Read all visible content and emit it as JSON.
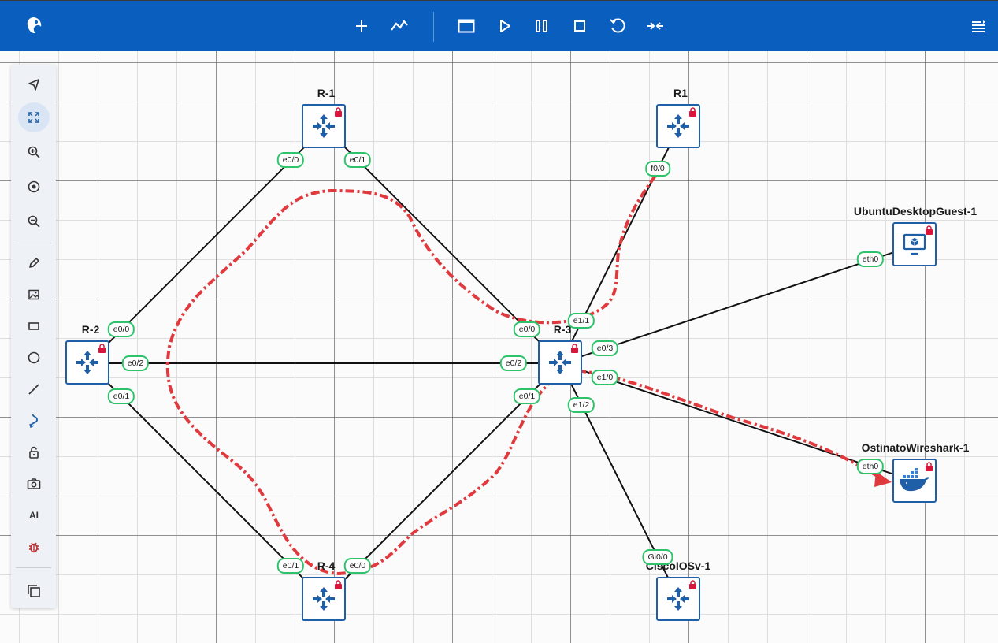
{
  "app": {
    "brand": "cml-logo-icon",
    "accent": "#0a5fbe"
  },
  "topbar": {
    "buttons": [
      "add-node",
      "graph",
      "console",
      "start",
      "pause",
      "stop",
      "reset",
      "collapse"
    ],
    "menu": "menu-icon"
  },
  "toolbox": {
    "tools": [
      "pointer",
      "fit-to-screen",
      "zoom-in",
      "center",
      "zoom-out",
      "pen",
      "image",
      "rectangle",
      "ellipse",
      "line",
      "curve",
      "lock",
      "camera",
      "ai",
      "bug",
      "copy"
    ],
    "ai_label": "AI",
    "active": "fit-to-screen"
  },
  "nodes": {
    "r_minus_1": {
      "label": "R-1",
      "type": "router",
      "locked": true
    },
    "r1": {
      "label": "R1",
      "type": "router",
      "locked": true
    },
    "r_minus_2": {
      "label": "R-2",
      "type": "router",
      "locked": true
    },
    "r_minus_3": {
      "label": "R-3",
      "type": "router",
      "locked": true
    },
    "r_minus_4": {
      "label": "R-4",
      "type": "router",
      "locked": true
    },
    "cisco_iosv_1": {
      "label": "CiscoIOSv-1",
      "type": "router",
      "locked": true
    },
    "ubuntu": {
      "label": "UbuntuDesktopGuest-1",
      "type": "desktop",
      "locked": true
    },
    "ostinato": {
      "label": "OstinatoWireshark-1",
      "type": "docker",
      "locked": true
    }
  },
  "interfaces": {
    "r_minus_1_e00": "e0/0",
    "r_minus_1_e01": "e0/1",
    "r1_f00": "f0/0",
    "ubuntu_eth0": "eth0",
    "r_minus_2_e00": "e0/0",
    "r_minus_2_e02": "e0/2",
    "r_minus_2_e01": "e0/1",
    "r_minus_3_e00": "e0/0",
    "r_minus_3_e11": "e1/1",
    "r_minus_3_e03": "e0/3",
    "r_minus_3_e02": "e0/2",
    "r_minus_3_e10": "e1/0",
    "r_minus_3_e01": "e0/1",
    "r_minus_3_e12": "e1/2",
    "ostinato_eth0": "eth0",
    "r_minus_4_e01": "e0/1",
    "r_minus_4_e00": "e0/0",
    "cisco_gi00": "Gi0/0"
  },
  "annotation": {
    "color": "#e03a3e"
  }
}
